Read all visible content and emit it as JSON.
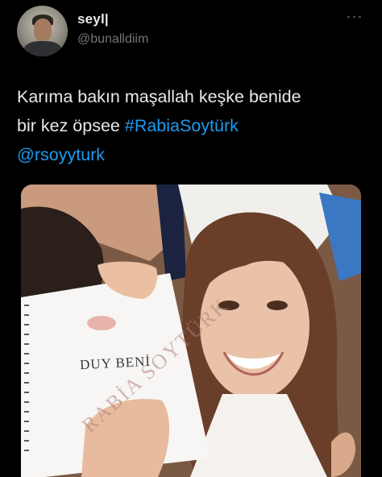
{
  "author": {
    "display_name": "seyl|",
    "handle": "@bunalldiim",
    "avatar_icon": "profile-photo"
  },
  "more_icon": "ellipsis-icon",
  "tweet": {
    "line1": "Karıma bakın maşallah keşke benide",
    "line2_text": "bir kez öpsee ",
    "hashtag": "#RabiaSoytürk",
    "mention": "@rsoyyturk"
  },
  "media": {
    "script_title": "DUY BENİ",
    "watermark": "RABİA SOYTÜRK"
  },
  "colors": {
    "background": "#000000",
    "text": "#e7e9ea",
    "secondary": "#71767b",
    "link": "#1d9bf0"
  }
}
